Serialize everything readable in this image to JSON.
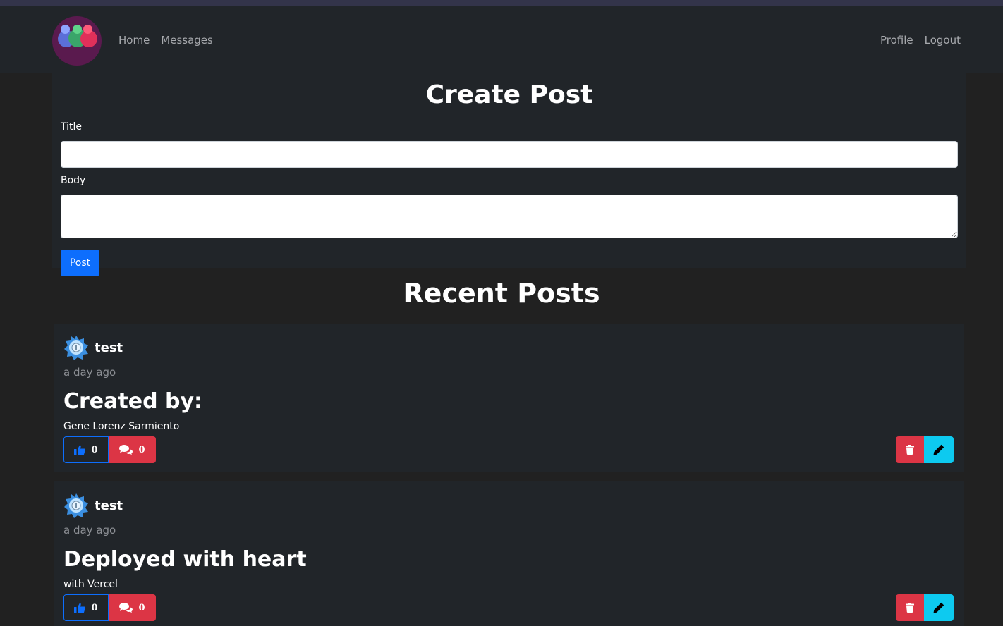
{
  "nav": {
    "logo_name": "app-logo",
    "links_left": [
      "Home",
      "Messages"
    ],
    "links_right": [
      "Profile",
      "Logout"
    ]
  },
  "create": {
    "heading": "Create Post",
    "title_label": "Title",
    "title_value": "",
    "body_label": "Body",
    "body_value": "",
    "submit_label": "Post"
  },
  "recent": {
    "heading": "Recent Posts",
    "posts": [
      {
        "author": "test",
        "time": "a day ago",
        "title": "Created by:",
        "body": "Gene Lorenz Sarmiento",
        "likes": "0",
        "comments": "0"
      },
      {
        "author": "test",
        "time": "a day ago",
        "title": "Deployed with heart",
        "body": "with Vercel",
        "likes": "0",
        "comments": "0"
      }
    ]
  },
  "colors": {
    "primary": "#0d6efd",
    "danger": "#dc3545",
    "info": "#0dcaf0",
    "card": "#212529",
    "page": "#212121"
  }
}
